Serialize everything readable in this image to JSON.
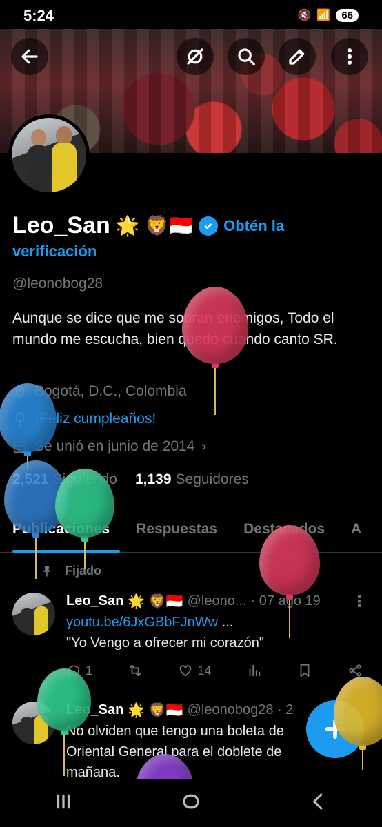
{
  "status_bar": {
    "time": "5:24",
    "battery": "66"
  },
  "profile": {
    "name": "Leo_San",
    "name_emojis": "🌟 🦁🇮🇩",
    "get_verified": "Obtén la",
    "get_verified_2": "verificación",
    "handle": "@leonobog28",
    "bio": "Aunque se dice que me sobran enemigos, Todo el mundo me escucha, bien quedo cuando canto SR.",
    "location": "Bogotá, D.C., Colombia",
    "birthday": "¡Feliz cumpleaños!",
    "joined": "Se unió en junio de 2014",
    "following_count": "2,521",
    "following_label": "Siguiendo",
    "followers_count": "1,139",
    "followers_label": "Seguidores"
  },
  "tabs": [
    {
      "label": "Publicaciones",
      "active": true
    },
    {
      "label": "Respuestas"
    },
    {
      "label": "Destacados"
    },
    {
      "label": "A"
    }
  ],
  "pinned_label": "Fijado",
  "posts": [
    {
      "name": "Leo_San",
      "emojis": "🌟 🦁🇮🇩",
      "handle": "@leono...",
      "date": "· 07 ago 19",
      "link": "youtu.be/6JxGBbFJnWw",
      "link_suffix": " ...",
      "text": "\"Yo Vengo a ofrecer mi corazón\"",
      "replies": "1",
      "likes": "14"
    },
    {
      "name": "Leo_San",
      "emojis": "🌟 🦁🇮🇩",
      "handle": "@leonobog28 · 2",
      "line1": "No olviden que tengo una boleta de",
      "line2": "Oriental General para el doblete de",
      "line3": "mañana."
    }
  ],
  "icons": [
    "back-arrow-icon",
    "grok-icon",
    "search-icon",
    "edit-icon",
    "more-icon",
    "location-icon",
    "balloon-icon",
    "calendar-icon",
    "pin-icon",
    "reply-icon",
    "retweet-icon",
    "like-icon",
    "views-icon",
    "bookmark-icon",
    "share-icon",
    "plus-icon"
  ],
  "colors": {
    "accent": "#1d9bf0",
    "background": "#000000",
    "secondary_text": "#71767b"
  }
}
